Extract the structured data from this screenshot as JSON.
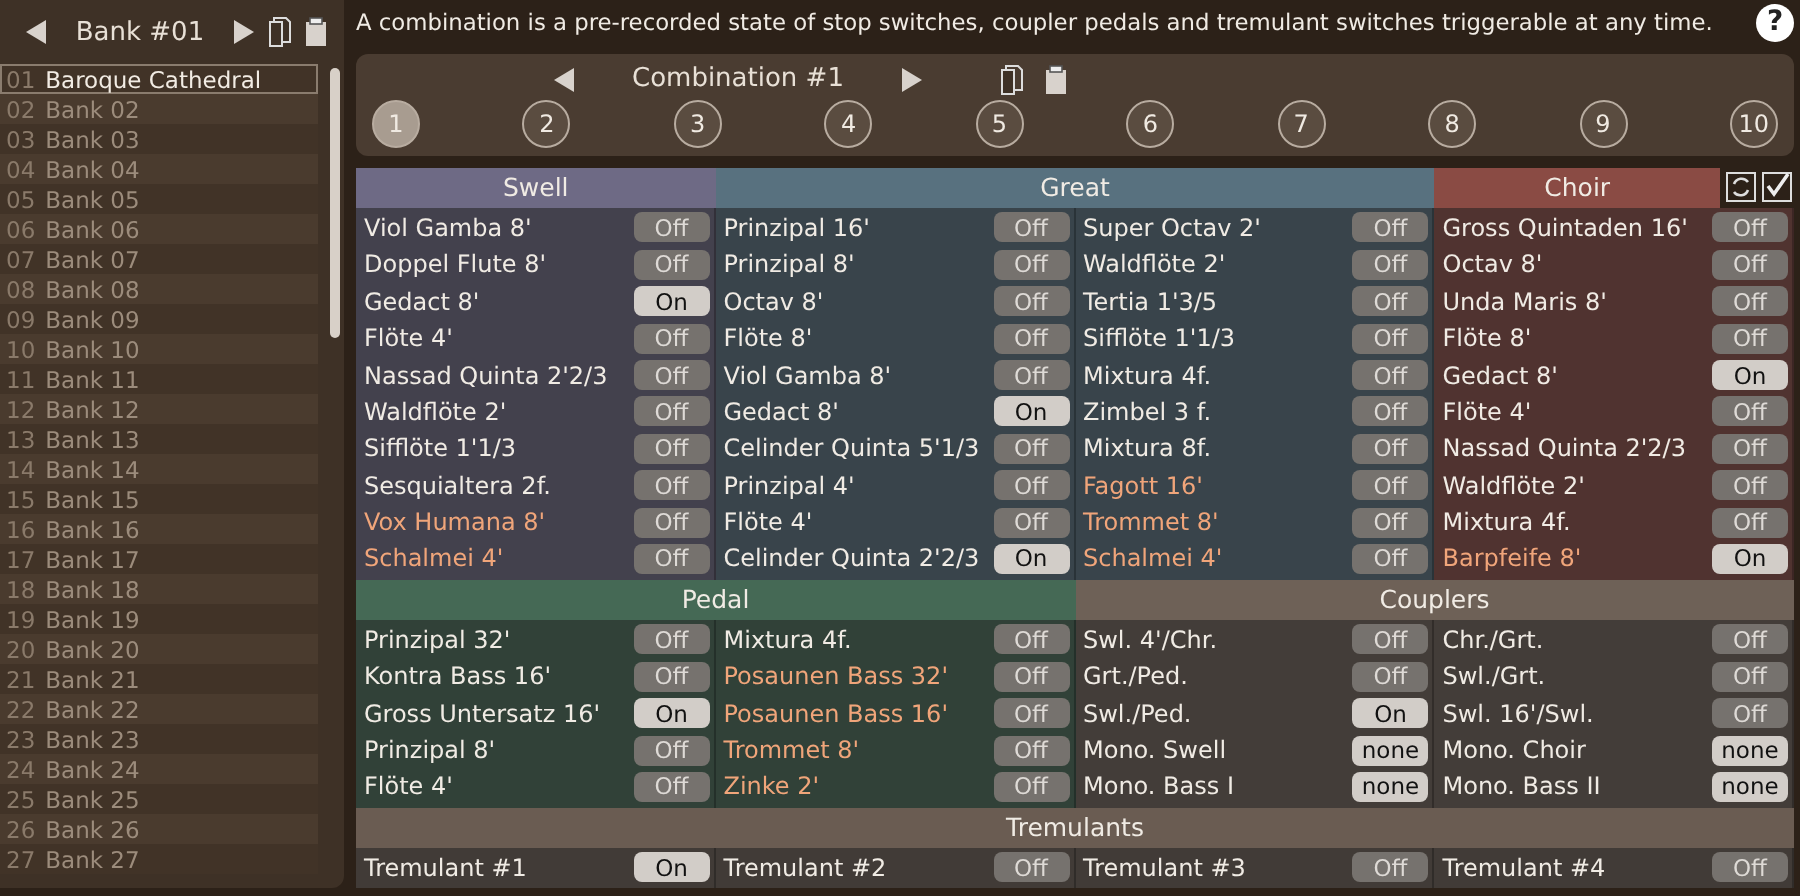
{
  "bank_header": {
    "title": "Bank #01"
  },
  "banks": [
    {
      "number": "01",
      "name": "Baroque Cathedral",
      "selected": true
    },
    {
      "number": "02",
      "name": "Bank 02",
      "selected": false
    },
    {
      "number": "03",
      "name": "Bank 03",
      "selected": false
    },
    {
      "number": "04",
      "name": "Bank 04",
      "selected": false
    },
    {
      "number": "05",
      "name": "Bank 05",
      "selected": false
    },
    {
      "number": "06",
      "name": "Bank 06",
      "selected": false
    },
    {
      "number": "07",
      "name": "Bank 07",
      "selected": false
    },
    {
      "number": "08",
      "name": "Bank 08",
      "selected": false
    },
    {
      "number": "09",
      "name": "Bank 09",
      "selected": false
    },
    {
      "number": "10",
      "name": "Bank 10",
      "selected": false
    },
    {
      "number": "11",
      "name": "Bank 11",
      "selected": false
    },
    {
      "number": "12",
      "name": "Bank 12",
      "selected": false
    },
    {
      "number": "13",
      "name": "Bank 13",
      "selected": false
    },
    {
      "number": "14",
      "name": "Bank 14",
      "selected": false
    },
    {
      "number": "15",
      "name": "Bank 15",
      "selected": false
    },
    {
      "number": "16",
      "name": "Bank 16",
      "selected": false
    },
    {
      "number": "17",
      "name": "Bank 17",
      "selected": false
    },
    {
      "number": "18",
      "name": "Bank 18",
      "selected": false
    },
    {
      "number": "19",
      "name": "Bank 19",
      "selected": false
    },
    {
      "number": "20",
      "name": "Bank 20",
      "selected": false
    },
    {
      "number": "21",
      "name": "Bank 21",
      "selected": false
    },
    {
      "number": "22",
      "name": "Bank 22",
      "selected": false
    },
    {
      "number": "23",
      "name": "Bank 23",
      "selected": false
    },
    {
      "number": "24",
      "name": "Bank 24",
      "selected": false
    },
    {
      "number": "25",
      "name": "Bank 25",
      "selected": false
    },
    {
      "number": "26",
      "name": "Bank 26",
      "selected": false
    },
    {
      "number": "27",
      "name": "Bank 27",
      "selected": false
    }
  ],
  "info": "A combination is a pre-recorded state of stop switches, coupler pedals and tremulant switches triggerable at any time.",
  "help_button": "?",
  "combination": {
    "title": "Combination #1",
    "slots": [
      {
        "label": "1",
        "selected": true
      },
      {
        "label": "2",
        "selected": false
      },
      {
        "label": "3",
        "selected": false
      },
      {
        "label": "4",
        "selected": false
      },
      {
        "label": "5",
        "selected": false
      },
      {
        "label": "6",
        "selected": false
      },
      {
        "label": "7",
        "selected": false
      },
      {
        "label": "8",
        "selected": false
      },
      {
        "label": "9",
        "selected": false
      },
      {
        "label": "10",
        "selected": false
      }
    ]
  },
  "groups": [
    {
      "sections": [
        {
          "title": "Swell",
          "color": "#6e6a85",
          "columns": [
            [
              {
                "name": "Viol Gamba 8'",
                "value": "Off",
                "on": false,
                "reed": false,
                "kind": "toggle"
              },
              {
                "name": "Doppel Flute 8'",
                "value": "Off",
                "on": false,
                "reed": false,
                "kind": "toggle"
              },
              {
                "name": "Gedact 8'",
                "value": "On",
                "on": true,
                "reed": false,
                "kind": "toggle"
              },
              {
                "name": "Flöte 4'",
                "value": "Off",
                "on": false,
                "reed": false,
                "kind": "toggle"
              },
              {
                "name": "Nassad Quinta 2'2/3",
                "value": "Off",
                "on": false,
                "reed": false,
                "kind": "toggle"
              },
              {
                "name": "Waldflöte 2'",
                "value": "Off",
                "on": false,
                "reed": false,
                "kind": "toggle"
              },
              {
                "name": "Sifflöte 1'1/3",
                "value": "Off",
                "on": false,
                "reed": false,
                "kind": "toggle"
              },
              {
                "name": "Sesquialtera 2f.",
                "value": "Off",
                "on": false,
                "reed": false,
                "kind": "toggle"
              },
              {
                "name": "Vox Humana 8'",
                "value": "Off",
                "on": false,
                "reed": true,
                "kind": "toggle"
              },
              {
                "name": "Schalmei 4'",
                "value": "Off",
                "on": false,
                "reed": true,
                "kind": "toggle"
              }
            ]
          ]
        },
        {
          "title": "Great",
          "color": "#58717f",
          "columns": [
            [
              {
                "name": "Prinzipal 16'",
                "value": "Off",
                "on": false,
                "reed": false,
                "kind": "toggle"
              },
              {
                "name": "Prinzipal 8'",
                "value": "Off",
                "on": false,
                "reed": false,
                "kind": "toggle"
              },
              {
                "name": "Octav 8'",
                "value": "Off",
                "on": false,
                "reed": false,
                "kind": "toggle"
              },
              {
                "name": "Flöte 8'",
                "value": "Off",
                "on": false,
                "reed": false,
                "kind": "toggle"
              },
              {
                "name": "Viol Gamba 8'",
                "value": "Off",
                "on": false,
                "reed": false,
                "kind": "toggle"
              },
              {
                "name": "Gedact 8'",
                "value": "On",
                "on": true,
                "reed": false,
                "kind": "toggle"
              },
              {
                "name": "Celinder Quinta 5'1/3",
                "value": "Off",
                "on": false,
                "reed": false,
                "kind": "toggle"
              },
              {
                "name": "Prinzipal 4'",
                "value": "Off",
                "on": false,
                "reed": false,
                "kind": "toggle"
              },
              {
                "name": "Flöte 4'",
                "value": "Off",
                "on": false,
                "reed": false,
                "kind": "toggle"
              },
              {
                "name": "Celinder Quinta 2'2/3",
                "value": "On",
                "on": true,
                "reed": false,
                "kind": "toggle"
              }
            ],
            [
              {
                "name": "Super Octav 2'",
                "value": "Off",
                "on": false,
                "reed": false,
                "kind": "toggle"
              },
              {
                "name": "Waldflöte 2'",
                "value": "Off",
                "on": false,
                "reed": false,
                "kind": "toggle"
              },
              {
                "name": "Tertia 1'3/5",
                "value": "Off",
                "on": false,
                "reed": false,
                "kind": "toggle"
              },
              {
                "name": "Sifflöte 1'1/3",
                "value": "Off",
                "on": false,
                "reed": false,
                "kind": "toggle"
              },
              {
                "name": "Mixtura 4f.",
                "value": "Off",
                "on": false,
                "reed": false,
                "kind": "toggle"
              },
              {
                "name": "Zimbel 3 f.",
                "value": "Off",
                "on": false,
                "reed": false,
                "kind": "toggle"
              },
              {
                "name": "Mixtura 8f.",
                "value": "Off",
                "on": false,
                "reed": false,
                "kind": "toggle"
              },
              {
                "name": "Fagott 16'",
                "value": "Off",
                "on": false,
                "reed": true,
                "kind": "toggle"
              },
              {
                "name": "Trommet 8'",
                "value": "Off",
                "on": false,
                "reed": true,
                "kind": "toggle"
              },
              {
                "name": "Schalmei 4'",
                "value": "Off",
                "on": false,
                "reed": true,
                "kind": "toggle"
              }
            ]
          ]
        },
        {
          "title": "Choir",
          "color": "#8a4b44",
          "columns": [
            [
              {
                "name": "Gross Quintaden 16'",
                "value": "Off",
                "on": false,
                "reed": false,
                "kind": "toggle"
              },
              {
                "name": "Octav 8'",
                "value": "Off",
                "on": false,
                "reed": false,
                "kind": "toggle"
              },
              {
                "name": "Unda Maris 8'",
                "value": "Off",
                "on": false,
                "reed": false,
                "kind": "toggle"
              },
              {
                "name": "Flöte 8'",
                "value": "Off",
                "on": false,
                "reed": false,
                "kind": "toggle"
              },
              {
                "name": "Gedact 8'",
                "value": "On",
                "on": true,
                "reed": false,
                "kind": "toggle"
              },
              {
                "name": "Flöte 4'",
                "value": "Off",
                "on": false,
                "reed": false,
                "kind": "toggle"
              },
              {
                "name": "Nassad Quinta 2'2/3",
                "value": "Off",
                "on": false,
                "reed": false,
                "kind": "toggle"
              },
              {
                "name": "Waldflöte 2'",
                "value": "Off",
                "on": false,
                "reed": false,
                "kind": "toggle"
              },
              {
                "name": "Mixtura 4f.",
                "value": "Off",
                "on": false,
                "reed": false,
                "kind": "toggle"
              },
              {
                "name": "Barpfeife 8'",
                "value": "On",
                "on": true,
                "reed": true,
                "kind": "toggle"
              }
            ]
          ]
        }
      ]
    },
    {
      "sections": [
        {
          "title": "Pedal",
          "color": "#456955",
          "columns": [
            [
              {
                "name": "Prinzipal 32'",
                "value": "Off",
                "on": false,
                "reed": false,
                "kind": "toggle"
              },
              {
                "name": "Kontra Bass 16'",
                "value": "Off",
                "on": false,
                "reed": false,
                "kind": "toggle"
              },
              {
                "name": "Gross Untersatz 16'",
                "value": "On",
                "on": true,
                "reed": false,
                "kind": "toggle"
              },
              {
                "name": "Prinzipal 8'",
                "value": "Off",
                "on": false,
                "reed": false,
                "kind": "toggle"
              },
              {
                "name": "Flöte 4'",
                "value": "Off",
                "on": false,
                "reed": false,
                "kind": "toggle"
              }
            ],
            [
              {
                "name": "Mixtura 4f.",
                "value": "Off",
                "on": false,
                "reed": false,
                "kind": "toggle"
              },
              {
                "name": "Posaunen Bass 32'",
                "value": "Off",
                "on": false,
                "reed": true,
                "kind": "toggle"
              },
              {
                "name": "Posaunen Bass 16'",
                "value": "Off",
                "on": false,
                "reed": true,
                "kind": "toggle"
              },
              {
                "name": "Trommet 8'",
                "value": "Off",
                "on": false,
                "reed": true,
                "kind": "toggle"
              },
              {
                "name": "Zinke 2'",
                "value": "Off",
                "on": false,
                "reed": true,
                "kind": "toggle"
              }
            ]
          ]
        },
        {
          "title": "Couplers",
          "color": "#6e6157",
          "columns": [
            [
              {
                "name": "Swl. 4'/Chr.",
                "value": "Off",
                "on": false,
                "reed": false,
                "kind": "toggle"
              },
              {
                "name": "Grt./Ped.",
                "value": "Off",
                "on": false,
                "reed": false,
                "kind": "toggle"
              },
              {
                "name": "Swl./Ped.",
                "value": "On",
                "on": true,
                "reed": false,
                "kind": "toggle"
              },
              {
                "name": "Mono. Swell",
                "value": "none",
                "reed": false,
                "kind": "select"
              },
              {
                "name": "Mono. Bass I",
                "value": "none",
                "reed": false,
                "kind": "select"
              }
            ],
            [
              {
                "name": "Chr./Grt.",
                "value": "Off",
                "on": false,
                "reed": false,
                "kind": "toggle"
              },
              {
                "name": "Swl./Grt.",
                "value": "Off",
                "on": false,
                "reed": false,
                "kind": "toggle"
              },
              {
                "name": "Swl. 16'/Swl.",
                "value": "Off",
                "on": false,
                "reed": false,
                "kind": "toggle"
              },
              {
                "name": "Mono. Choir",
                "value": "none",
                "reed": false,
                "kind": "select"
              },
              {
                "name": "Mono. Bass II",
                "value": "none",
                "reed": false,
                "kind": "select"
              }
            ]
          ]
        }
      ]
    },
    {
      "sections": [
        {
          "title": "Tremulants",
          "color": "#6a5c52",
          "columns": [
            [
              {
                "name": "Tremulant #1",
                "value": "On",
                "on": true,
                "reed": false,
                "kind": "toggle"
              }
            ],
            [
              {
                "name": "Tremulant #2",
                "value": "Off",
                "on": false,
                "reed": false,
                "kind": "toggle"
              }
            ],
            [
              {
                "name": "Tremulant #3",
                "value": "Off",
                "on": false,
                "reed": false,
                "kind": "toggle"
              }
            ],
            [
              {
                "name": "Tremulant #4",
                "value": "Off",
                "on": false,
                "reed": false,
                "kind": "toggle"
              }
            ]
          ]
        }
      ]
    }
  ]
}
